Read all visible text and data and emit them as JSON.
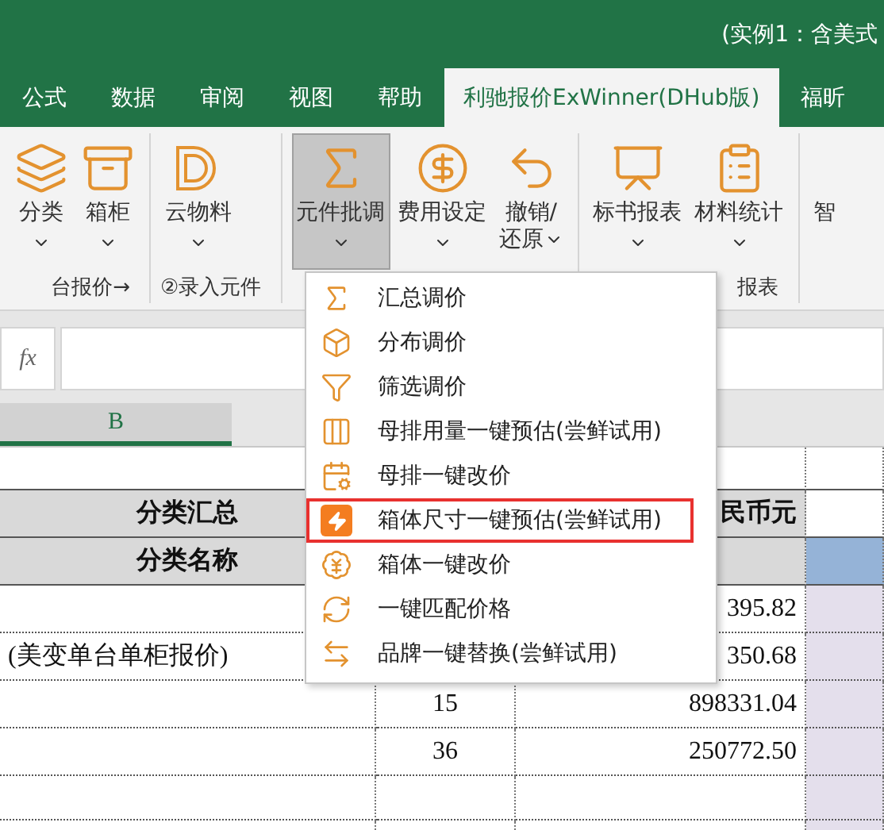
{
  "title": "(实例1：含美式",
  "tabs": [
    {
      "label": "公式",
      "selected": false
    },
    {
      "label": "数据",
      "selected": false
    },
    {
      "label": "审阅",
      "selected": false
    },
    {
      "label": "视图",
      "selected": false
    },
    {
      "label": "帮助",
      "selected": false
    },
    {
      "label": "利驰报价ExWinner(DHub版)",
      "selected": true
    },
    {
      "label": "福昕",
      "selected": false
    }
  ],
  "ribbon_groups": [
    {
      "label": "台报价→",
      "buttons": [
        {
          "label": [
            "分类"
          ],
          "selected": false
        },
        {
          "label": [
            "箱柜"
          ],
          "selected": false
        }
      ]
    },
    {
      "label": "②录入元件",
      "buttons": [
        {
          "label": [
            "云物料"
          ],
          "selected": false
        }
      ]
    },
    {
      "buttons": [
        {
          "label": [
            "元件批调"
          ],
          "selected": true
        },
        {
          "label": [
            "费用设定"
          ],
          "selected": false
        },
        {
          "label": [
            "撤销/",
            "还原"
          ],
          "selected": false
        }
      ]
    },
    {
      "label": "报表",
      "buttons": [
        {
          "label": [
            "标书报表"
          ],
          "selected": false
        },
        {
          "label": [
            "材料统计"
          ],
          "selected": false
        }
      ]
    },
    {
      "buttons": [
        {
          "label": [
            "智"
          ],
          "selected": false
        }
      ]
    }
  ],
  "formula_bar": {
    "fx": "fx"
  },
  "columns": [
    {
      "label": "B",
      "selected": true
    }
  ],
  "rows": [
    {
      "kind": "blank"
    },
    {
      "kind": "title",
      "name": "分类汇总",
      "amount": "民币元"
    },
    {
      "kind": "header",
      "name": "分类名称"
    },
    {
      "kind": "data",
      "amount": "395.82"
    },
    {
      "kind": "data",
      "name": "(美变单台单柜报价)",
      "amount": "350.68"
    },
    {
      "kind": "data",
      "count": "15",
      "amount": "898331.04"
    },
    {
      "kind": "data",
      "count": "36",
      "amount": "250772.50"
    },
    {
      "kind": "data"
    },
    {
      "kind": "data"
    }
  ],
  "menu": [
    {
      "label": "汇总调价",
      "highlighted": false
    },
    {
      "label": "分布调价",
      "highlighted": false
    },
    {
      "label": "筛选调价",
      "highlighted": false
    },
    {
      "label": "母排用量一键预估(尝鲜试用)",
      "highlighted": false
    },
    {
      "label": "母排一键改价",
      "highlighted": false
    },
    {
      "label": "箱体尺寸一键预估(尝鲜试用)",
      "highlighted": true
    },
    {
      "label": "箱体一键改价",
      "highlighted": false
    },
    {
      "label": "一键匹配价格",
      "highlighted": false
    },
    {
      "label": "品牌一键替换(尝鲜试用)",
      "highlighted": false
    }
  ]
}
